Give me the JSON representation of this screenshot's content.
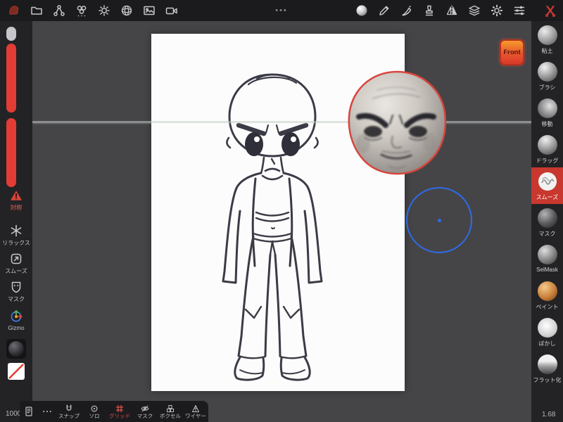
{
  "colors": {
    "accent_red": "#e23c35",
    "selection_red": "#c8382f",
    "cursor_blue": "#2e6ce6",
    "outline_red": "#d8453c",
    "toolbar_bg": "#1b1b1d",
    "panel_bg": "#232326",
    "canvas_bg": "#454548",
    "front_button_orange": "#f59a2c"
  },
  "topbar": {
    "center_handle": "•••",
    "left_icons": [
      "app-logo-icon",
      "folder-icon",
      "scene-graph-icon",
      "materials-icon",
      "lighting-icon",
      "environment-icon",
      "image-icon",
      "camera-icon"
    ],
    "right_icons": [
      "matcap-sphere-icon",
      "pencil-icon",
      "paint-knife-icon",
      "stamp-icon",
      "symmetry-icon",
      "layers-icon",
      "gear-icon",
      "sliders-icon",
      "red-cross-tools-icon"
    ]
  },
  "viewport": {
    "front_button_label": "Front",
    "scale_indicator": "1.68"
  },
  "left_panel": {
    "symmetry_label": "対称",
    "vertex_count": "1000",
    "tools": [
      {
        "icon": "relax-icon",
        "label": "リラックス"
      },
      {
        "icon": "smooth-icon",
        "label": "スムーズ"
      },
      {
        "icon": "mask-icon",
        "label": "マスク"
      },
      {
        "icon": "gizmo-icon",
        "label": "Gizmo"
      }
    ]
  },
  "bottom_bar": {
    "items": [
      {
        "icon": "magnet-icon",
        "label": "スナップ",
        "active": false
      },
      {
        "icon": "solo-icon",
        "label": "ソロ",
        "active": false
      },
      {
        "icon": "grid-icon",
        "label": "グリッド",
        "active": true
      },
      {
        "icon": "mask-eye-icon",
        "label": "マスク",
        "active": false
      },
      {
        "icon": "voxel-icon",
        "label": "ボクセル",
        "active": false
      },
      {
        "icon": "wireframe-icon",
        "label": "ワイヤー",
        "active": false
      }
    ]
  },
  "right_panel": {
    "tools": [
      {
        "label": "粘土",
        "selected": false
      },
      {
        "label": "ブラシ",
        "selected": false
      },
      {
        "label": "移動",
        "selected": false
      },
      {
        "label": "ドラッグ",
        "selected": false
      },
      {
        "label": "スムーズ",
        "selected": true
      },
      {
        "label": "マスク",
        "selected": false
      },
      {
        "label": "SelMask",
        "selected": false
      },
      {
        "label": "ペイント",
        "selected": false
      },
      {
        "label": "ぼかし",
        "selected": false
      },
      {
        "label": "フラット化",
        "selected": false
      }
    ]
  }
}
